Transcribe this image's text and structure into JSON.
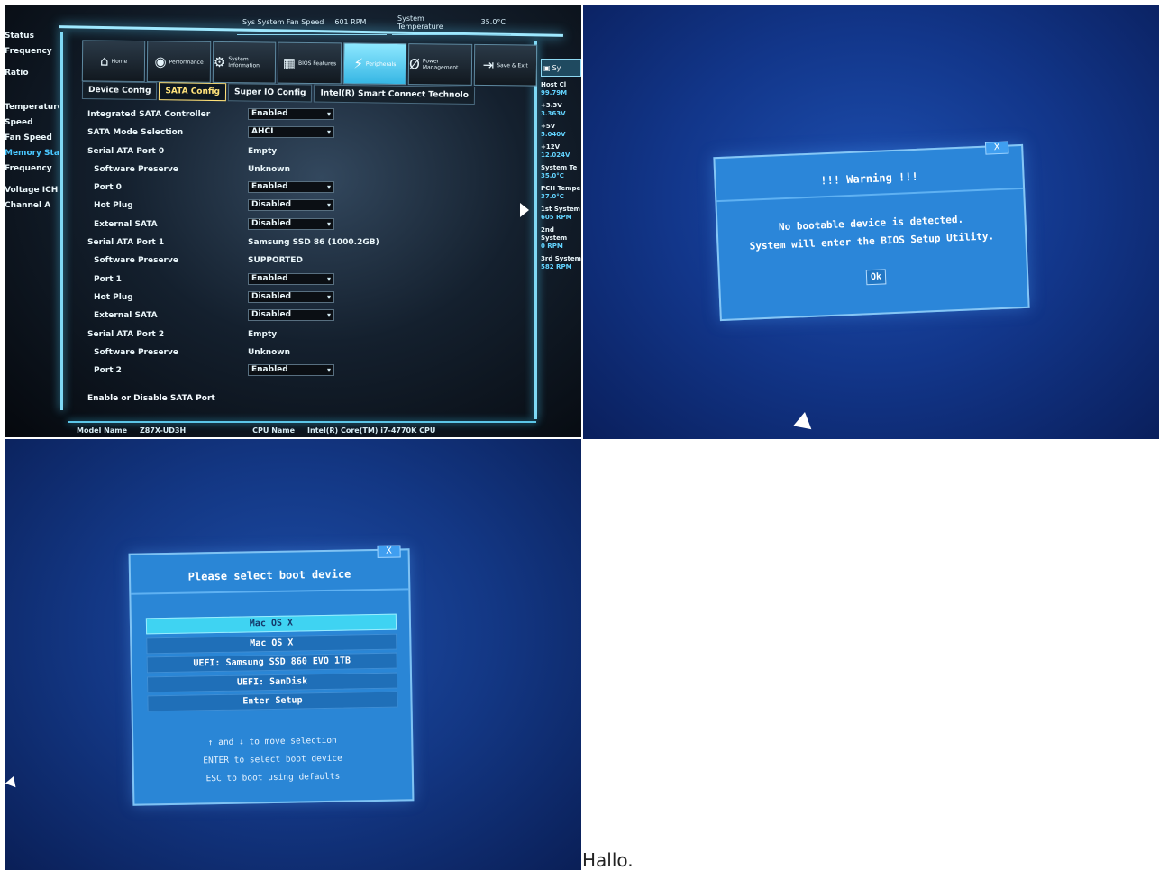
{
  "bios": {
    "top_info": [
      {
        "label": "Sys System Fan Speed",
        "value": "601 RPM"
      },
      {
        "label": "System Temperature",
        "value": "35.0°C"
      }
    ],
    "nav": [
      {
        "label": "Home",
        "icon": "home-icon",
        "glyph": "⌂"
      },
      {
        "label": "Performance",
        "icon": "performance-icon",
        "glyph": "◉"
      },
      {
        "label": "System Information",
        "icon": "gear-icon",
        "glyph": "⚙"
      },
      {
        "label": "BIOS Features",
        "icon": "chip-icon",
        "glyph": "▦"
      },
      {
        "label": "Peripherals",
        "icon": "peripherals-icon",
        "glyph": "⚡"
      },
      {
        "label": "Power Management",
        "icon": "power-icon",
        "glyph": "Ø"
      },
      {
        "label": "Save & Exit",
        "icon": "exit-icon",
        "glyph": "⇥"
      }
    ],
    "tabs": [
      "Device Config",
      "SATA Config",
      "Super IO Config",
      "Intel(R) Smart Connect Technolo"
    ],
    "rows": [
      {
        "label": "Integrated SATA Controller",
        "value": "Enabled",
        "sub": false,
        "box": true
      },
      {
        "label": "SATA Mode Selection",
        "value": "AHCI",
        "sub": false,
        "box": true
      },
      {
        "label": "Serial ATA Port 0",
        "value": "Empty",
        "sub": false,
        "box": false
      },
      {
        "label": "Software Preserve",
        "value": "Unknown",
        "sub": true,
        "box": false
      },
      {
        "label": "Port 0",
        "value": "Enabled",
        "sub": true,
        "box": true
      },
      {
        "label": "Hot Plug",
        "value": "Disabled",
        "sub": true,
        "box": true
      },
      {
        "label": "External SATA",
        "value": "Disabled",
        "sub": true,
        "box": true
      },
      {
        "label": "Serial ATA Port 1",
        "value": "Samsung SSD 86 (1000.2GB)",
        "sub": false,
        "box": false
      },
      {
        "label": "Software Preserve",
        "value": "SUPPORTED",
        "sub": true,
        "box": false
      },
      {
        "label": "Port 1",
        "value": "Enabled",
        "sub": true,
        "box": true
      },
      {
        "label": "Hot Plug",
        "value": "Disabled",
        "sub": true,
        "box": true
      },
      {
        "label": "External SATA",
        "value": "Disabled",
        "sub": true,
        "box": true
      },
      {
        "label": "Serial ATA Port 2",
        "value": "Empty",
        "sub": false,
        "box": false
      },
      {
        "label": "Software Preserve",
        "value": "Unknown",
        "sub": true,
        "box": false
      },
      {
        "label": "Port 2",
        "value": "Enabled",
        "sub": true,
        "box": true
      }
    ],
    "hint": "Enable or Disable SATA Port",
    "bottom": {
      "model_label": "Model Name",
      "model_value": "Z87X-UD3H",
      "cpu_label": "CPU Name",
      "cpu_value": "Intel(R) Core(TM) i7-4770K CPU"
    },
    "left_col": [
      "Status",
      "Frequency",
      "",
      "Ratio",
      "",
      "",
      "",
      "Temperature",
      "Speed",
      "Fan Speed",
      "Memory Status",
      "Frequency",
      "",
      "Voltage   ICH A/A",
      "Channel A"
    ],
    "right_col": {
      "header": "Sy",
      "items": [
        {
          "label": "Host Cl",
          "value": "99.79M"
        },
        {
          "label": "+3.3V",
          "value": "3.363V"
        },
        {
          "label": "+5V",
          "value": "5.040V"
        },
        {
          "label": "+12V",
          "value": "12.024V"
        },
        {
          "label": "System Te",
          "value": "35.0°C"
        },
        {
          "label": "PCH Tempe",
          "value": "37.0°C"
        },
        {
          "label": "1st System",
          "value": "605 RPM"
        },
        {
          "label": "2nd System",
          "value": "0 RPM"
        },
        {
          "label": "3rd System",
          "value": "582 RPM"
        }
      ]
    }
  },
  "warning": {
    "close": "X",
    "title": "!!! Warning !!!",
    "line1": "No bootable device is detected.",
    "line2": "System will enter the BIOS Setup Utility.",
    "ok": "Ok"
  },
  "boot_menu": {
    "close": "X",
    "title": "Please select boot device",
    "options": [
      "Mac OS X",
      "Mac OS X",
      "UEFI: Samsung SSD 860 EVO 1TB",
      "UEFI: SanDisk",
      "Enter Setup"
    ],
    "selected_index": 0,
    "help1": "↑ and ↓ to move selection",
    "help2": "ENTER to select boot device",
    "help3": "ESC to boot using defaults"
  },
  "caption": "Hallo."
}
